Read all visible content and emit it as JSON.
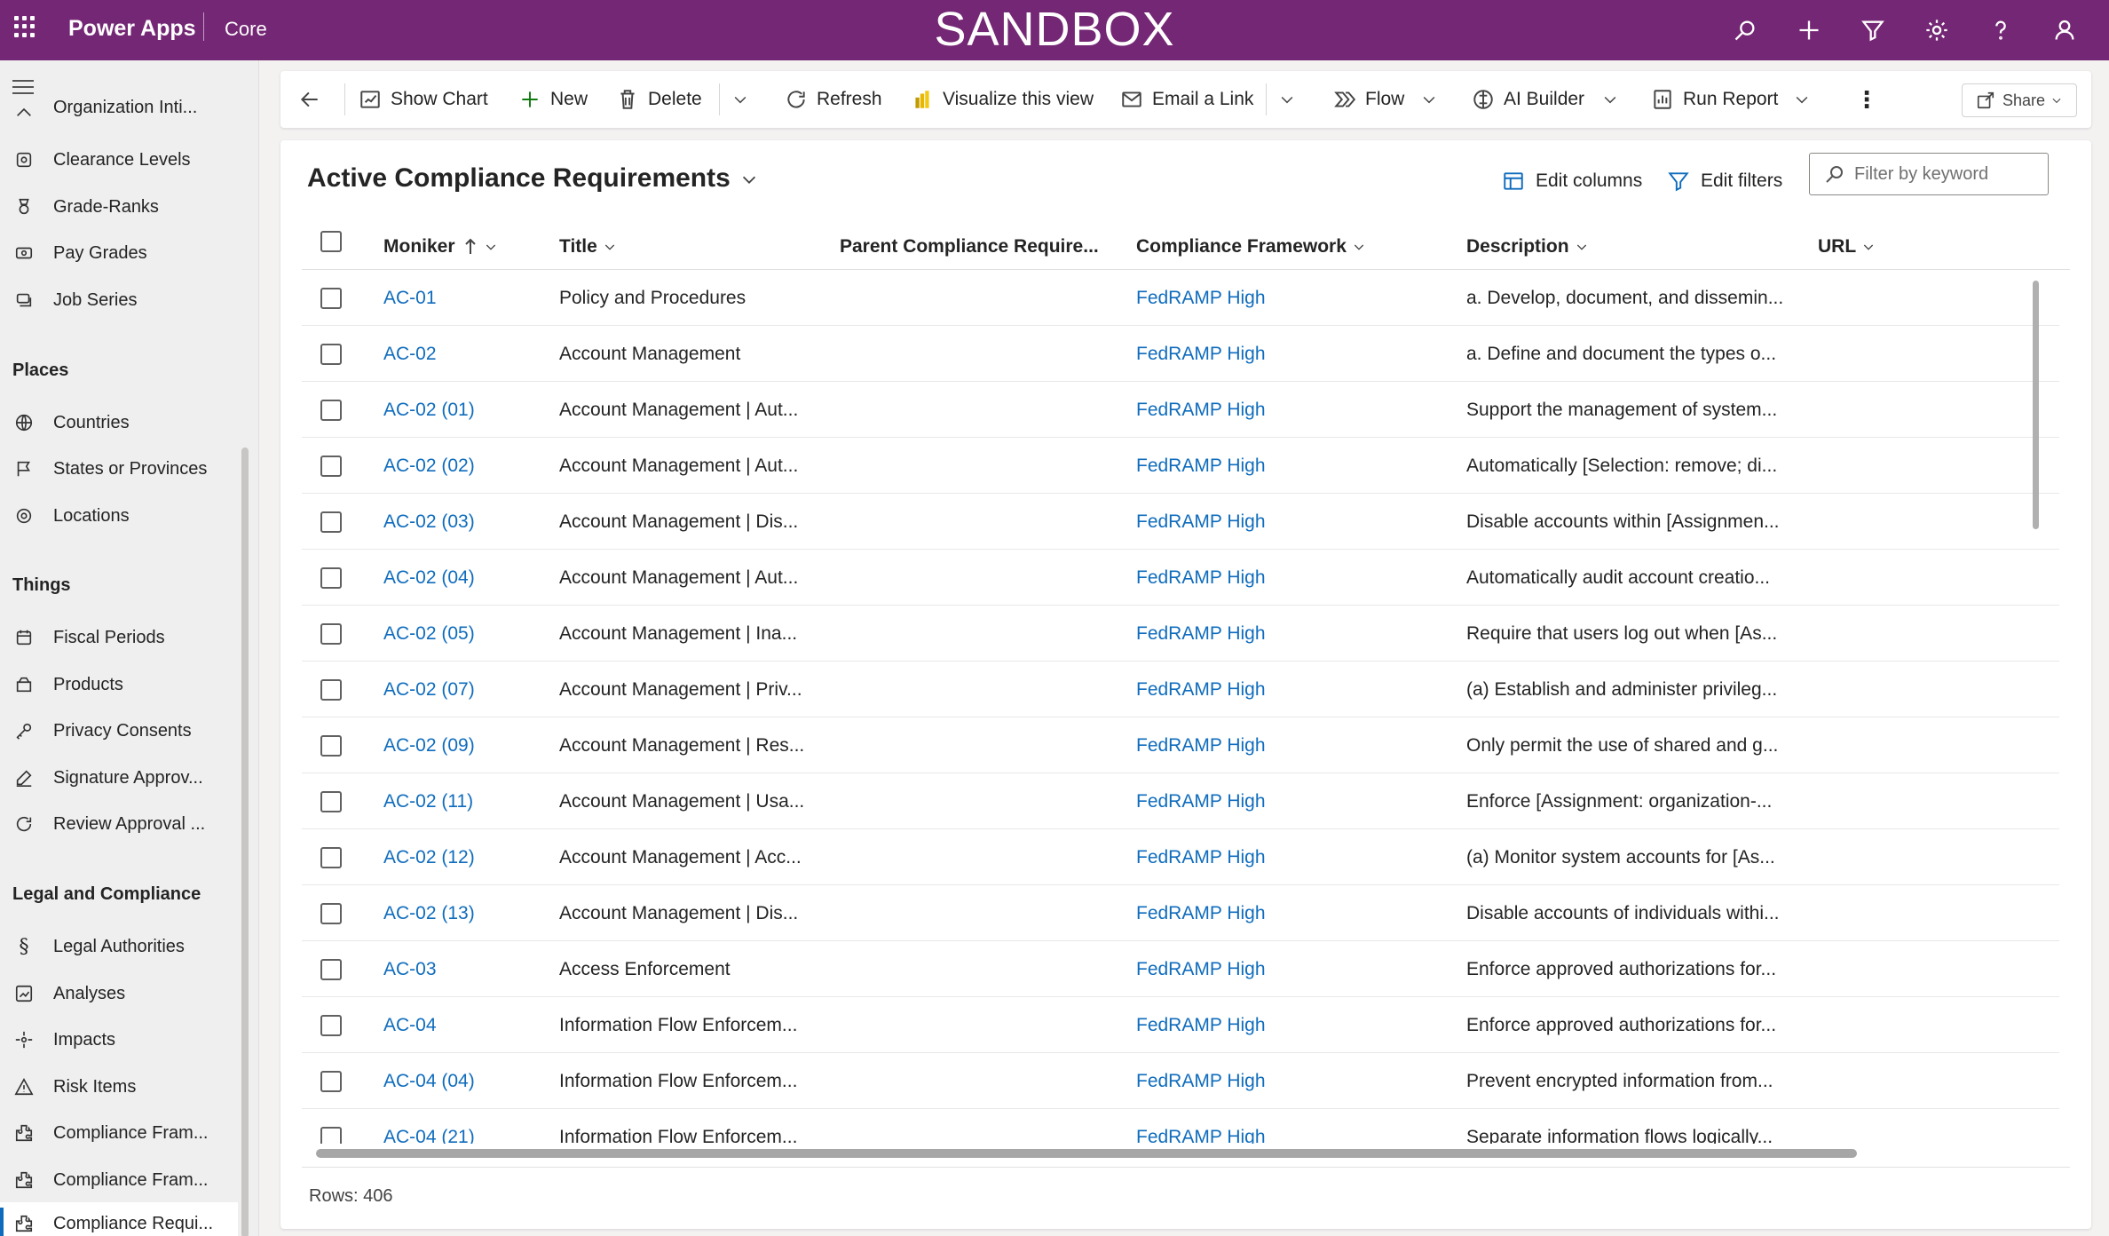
{
  "topbar": {
    "app_name": "Power Apps",
    "environment": "Core",
    "banner": "SANDBOX",
    "icons": [
      "search-icon",
      "plus-icon",
      "filter-icon",
      "gear-icon",
      "help-icon",
      "person-icon"
    ]
  },
  "sidebar": {
    "partial_top_item": "Organization Inti...",
    "items_top": [
      {
        "label": "Clearance Levels",
        "icon": "clearance-icon"
      },
      {
        "label": "Grade-Ranks",
        "icon": "medal-icon"
      },
      {
        "label": "Pay Grades",
        "icon": "money-icon"
      },
      {
        "label": "Job Series",
        "icon": "stack-icon"
      }
    ],
    "groups": [
      {
        "title": "Places",
        "items": [
          {
            "label": "Countries",
            "icon": "globe-icon"
          },
          {
            "label": "States or Provinces",
            "icon": "flag-icon"
          },
          {
            "label": "Locations",
            "icon": "location-icon"
          }
        ]
      },
      {
        "title": "Things",
        "items": [
          {
            "label": "Fiscal Periods",
            "icon": "calendar-icon"
          },
          {
            "label": "Products",
            "icon": "box-icon"
          },
          {
            "label": "Privacy Consents",
            "icon": "key-icon"
          },
          {
            "label": "Signature Approv...",
            "icon": "pen-icon"
          },
          {
            "label": "Review Approval ...",
            "icon": "review-icon"
          }
        ]
      },
      {
        "title": "Legal and Compliance",
        "items": [
          {
            "label": "Legal Authorities",
            "icon": "section-icon"
          },
          {
            "label": "Analyses",
            "icon": "analysis-icon"
          },
          {
            "label": "Impacts",
            "icon": "impact-icon"
          },
          {
            "label": "Risk Items",
            "icon": "warning-icon"
          },
          {
            "label": "Compliance Fram...",
            "icon": "puzzle-icon"
          },
          {
            "label": "Compliance Fram...",
            "icon": "puzzle-icon"
          },
          {
            "label": "Compliance Requi...",
            "icon": "puzzle-icon",
            "active": true
          }
        ]
      }
    ]
  },
  "commandbar": {
    "back": "back-arrow-icon",
    "show_chart": "Show Chart",
    "new": "New",
    "delete": "Delete",
    "refresh": "Refresh",
    "visualize": "Visualize this view",
    "email_link": "Email a Link",
    "flow": "Flow",
    "ai_builder": "AI Builder",
    "run_report": "Run Report",
    "share": "Share"
  },
  "view": {
    "title": "Active Compliance Requirements",
    "edit_columns": "Edit columns",
    "edit_filters": "Edit filters",
    "filter_placeholder": "Filter by keyword",
    "rows_label": "Rows: 406"
  },
  "grid": {
    "columns": [
      "Moniker",
      "Title",
      "Parent Compliance Require...",
      "Compliance Framework",
      "Description",
      "URL"
    ],
    "rows": [
      {
        "moniker": "AC-01",
        "title": "Policy and Procedures",
        "parent": "",
        "framework": "FedRAMP High",
        "description": "a. Develop, document, and dissemin..."
      },
      {
        "moniker": "AC-02",
        "title": "Account Management",
        "parent": "",
        "framework": "FedRAMP High",
        "description": "a. Define and document the types o..."
      },
      {
        "moniker": "AC-02 (01)",
        "title": "Account Management | Aut...",
        "parent": "",
        "framework": "FedRAMP High",
        "description": "Support the management of system..."
      },
      {
        "moniker": "AC-02 (02)",
        "title": "Account Management | Aut...",
        "parent": "",
        "framework": "FedRAMP High",
        "description": "Automatically [Selection: remove; di..."
      },
      {
        "moniker": "AC-02 (03)",
        "title": "Account Management | Dis...",
        "parent": "",
        "framework": "FedRAMP High",
        "description": "Disable accounts within [Assignmen..."
      },
      {
        "moniker": "AC-02 (04)",
        "title": "Account Management | Aut...",
        "parent": "",
        "framework": "FedRAMP High",
        "description": "Automatically audit account creatio..."
      },
      {
        "moniker": "AC-02 (05)",
        "title": "Account Management | Ina...",
        "parent": "",
        "framework": "FedRAMP High",
        "description": "Require that users log out when [As..."
      },
      {
        "moniker": "AC-02 (07)",
        "title": "Account Management | Priv...",
        "parent": "",
        "framework": "FedRAMP High",
        "description": "(a) Establish and administer privileg..."
      },
      {
        "moniker": "AC-02 (09)",
        "title": "Account Management | Res...",
        "parent": "",
        "framework": "FedRAMP High",
        "description": "Only permit the use of shared and g..."
      },
      {
        "moniker": "AC-02 (11)",
        "title": "Account Management | Usa...",
        "parent": "",
        "framework": "FedRAMP High",
        "description": "Enforce [Assignment: organization-..."
      },
      {
        "moniker": "AC-02 (12)",
        "title": "Account Management | Acc...",
        "parent": "",
        "framework": "FedRAMP High",
        "description": "(a) Monitor system accounts for [As..."
      },
      {
        "moniker": "AC-02 (13)",
        "title": "Account Management | Dis...",
        "parent": "",
        "framework": "FedRAMP High",
        "description": "Disable accounts of individuals withi..."
      },
      {
        "moniker": "AC-03",
        "title": "Access Enforcement",
        "parent": "",
        "framework": "FedRAMP High",
        "description": "Enforce approved authorizations for..."
      },
      {
        "moniker": "AC-04",
        "title": "Information Flow Enforcem...",
        "parent": "",
        "framework": "FedRAMP High",
        "description": "Enforce approved authorizations for..."
      },
      {
        "moniker": "AC-04 (04)",
        "title": "Information Flow Enforcem...",
        "parent": "",
        "framework": "FedRAMP High",
        "description": "Prevent encrypted information from..."
      },
      {
        "moniker": "AC-04 (21)",
        "title": "Information Flow Enforcem...",
        "parent": "",
        "framework": "FedRAMP High",
        "description": "Separate information flows logically..."
      }
    ]
  }
}
